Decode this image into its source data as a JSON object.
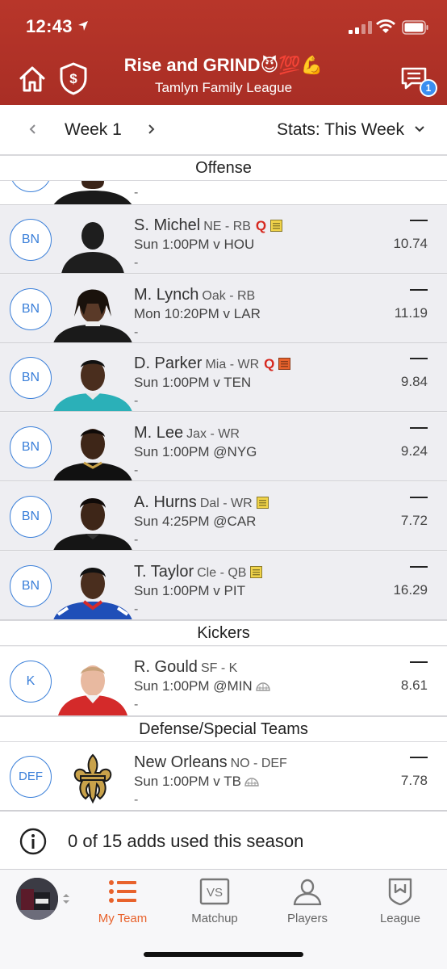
{
  "status": {
    "time": "12:43"
  },
  "header": {
    "title": "Rise and GRIND😈💯💪",
    "subtitle": "Tamlyn Family League",
    "chat_badge": "1"
  },
  "week": {
    "label": "Week 1",
    "stats_label": "Stats: This Week"
  },
  "sections": {
    "offense": "Offense",
    "kickers": "Kickers",
    "defense": "Defense/Special Teams"
  },
  "players": [
    {
      "slot": "BN",
      "name": "S. Michel",
      "pos": "NE - RB",
      "status": "Q",
      "note": "yellow",
      "game": "Sun 1:00PM v HOU",
      "dash": "-",
      "actual": "—",
      "proj": "10.74"
    },
    {
      "slot": "BN",
      "name": "M. Lynch",
      "pos": "Oak - RB",
      "status": "",
      "note": "",
      "game": "Mon 10:20PM v LAR",
      "dash": "-",
      "actual": "—",
      "proj": "11.19"
    },
    {
      "slot": "BN",
      "name": "D. Parker",
      "pos": "Mia - WR",
      "status": "Q",
      "note": "orange",
      "game": "Sun 1:00PM v TEN",
      "dash": "-",
      "actual": "—",
      "proj": "9.84"
    },
    {
      "slot": "BN",
      "name": "M. Lee",
      "pos": "Jax - WR",
      "status": "",
      "note": "",
      "game": "Sun 1:00PM @NYG",
      "dash": "-",
      "actual": "—",
      "proj": "9.24"
    },
    {
      "slot": "BN",
      "name": "A. Hurns",
      "pos": "Dal - WR",
      "status": "",
      "note": "yellow",
      "game": "Sun 4:25PM @CAR",
      "dash": "-",
      "actual": "—",
      "proj": "7.72"
    },
    {
      "slot": "BN",
      "name": "T. Taylor",
      "pos": "Cle - QB",
      "status": "",
      "note": "yellow",
      "game": "Sun 1:00PM v PIT",
      "dash": "-",
      "actual": "—",
      "proj": "16.29"
    }
  ],
  "kicker": {
    "slot": "K",
    "name": "R. Gould",
    "pos": "SF - K",
    "game": "Sun 1:00PM @MIN",
    "dash": "-",
    "actual": "—",
    "proj": "8.61"
  },
  "defense": {
    "slot": "DEF",
    "name": "New Orleans",
    "pos": "NO - DEF",
    "game": "Sun 1:00PM v TB",
    "dash": "-",
    "actual": "—",
    "proj": "7.78"
  },
  "adds": {
    "text": "0 of 15 adds used this season"
  },
  "tabs": [
    {
      "label": "My Team",
      "icon": "list-icon",
      "active": true
    },
    {
      "label": "Matchup",
      "icon": "vs-icon",
      "active": false
    },
    {
      "label": "Players",
      "icon": "person-icon",
      "active": false
    },
    {
      "label": "League",
      "icon": "shield-icon",
      "active": false
    }
  ],
  "colors": {
    "header": "#b8362a",
    "accent": "#e8622c",
    "slot_blue": "#3a7fd9",
    "questionable": "#d6281f"
  }
}
